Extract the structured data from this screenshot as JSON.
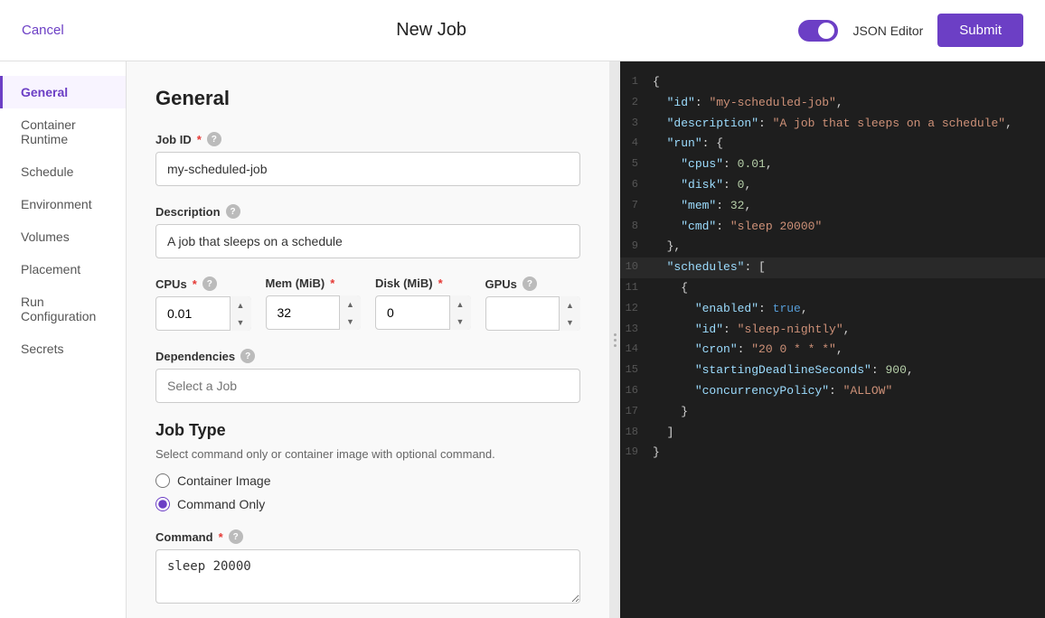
{
  "header": {
    "cancel_label": "Cancel",
    "title": "New Job",
    "json_editor_label": "JSON Editor",
    "submit_label": "Submit"
  },
  "sidebar": {
    "items": [
      {
        "id": "general",
        "label": "General",
        "active": true
      },
      {
        "id": "container-runtime",
        "label": "Container Runtime",
        "active": false
      },
      {
        "id": "schedule",
        "label": "Schedule",
        "active": false
      },
      {
        "id": "environment",
        "label": "Environment",
        "active": false
      },
      {
        "id": "volumes",
        "label": "Volumes",
        "active": false
      },
      {
        "id": "placement",
        "label": "Placement",
        "active": false
      },
      {
        "id": "run-configuration",
        "label": "Run Configuration",
        "active": false
      },
      {
        "id": "secrets",
        "label": "Secrets",
        "active": false
      }
    ]
  },
  "form": {
    "section_title": "General",
    "job_id_label": "Job ID",
    "job_id_value": "my-scheduled-job",
    "description_label": "Description",
    "description_value": "A job that sleeps on a schedule",
    "cpus_label": "CPUs",
    "cpus_value": "0.01",
    "mem_label": "Mem (MiB)",
    "mem_value": "32",
    "disk_label": "Disk (MiB)",
    "disk_value": "0",
    "gpus_label": "GPUs",
    "gpus_value": "",
    "dependencies_label": "Dependencies",
    "dependencies_placeholder": "Select a Job",
    "job_type_title": "Job Type",
    "job_type_desc": "Select command only or container image with optional command.",
    "container_image_label": "Container Image",
    "command_only_label": "Command Only",
    "command_label": "Command",
    "command_value": "sleep 20000"
  },
  "json_editor": {
    "lines": [
      {
        "num": 1,
        "content": "{"
      },
      {
        "num": 2,
        "content": "  \"id\": \"my-scheduled-job\","
      },
      {
        "num": 3,
        "content": "  \"description\": \"A job that sleeps on a schedule\","
      },
      {
        "num": 4,
        "content": "  \"run\": {"
      },
      {
        "num": 5,
        "content": "    \"cpus\": 0.01,"
      },
      {
        "num": 6,
        "content": "    \"disk\": 0,"
      },
      {
        "num": 7,
        "content": "    \"mem\": 32,"
      },
      {
        "num": 8,
        "content": "    \"cmd\": \"sleep 20000\""
      },
      {
        "num": 9,
        "content": "  },"
      },
      {
        "num": 10,
        "content": "  \"schedules\": [",
        "highlighted": true
      },
      {
        "num": 11,
        "content": "    {"
      },
      {
        "num": 12,
        "content": "      \"enabled\": true,"
      },
      {
        "num": 13,
        "content": "      \"id\": \"sleep-nightly\","
      },
      {
        "num": 14,
        "content": "      \"cron\": \"20 0 * * *\","
      },
      {
        "num": 15,
        "content": "      \"startingDeadlineSeconds\": 900,"
      },
      {
        "num": 16,
        "content": "      \"concurrencyPolicy\": \"ALLOW\""
      },
      {
        "num": 17,
        "content": "    }"
      },
      {
        "num": 18,
        "content": "  ]"
      },
      {
        "num": 19,
        "content": "}"
      }
    ]
  }
}
